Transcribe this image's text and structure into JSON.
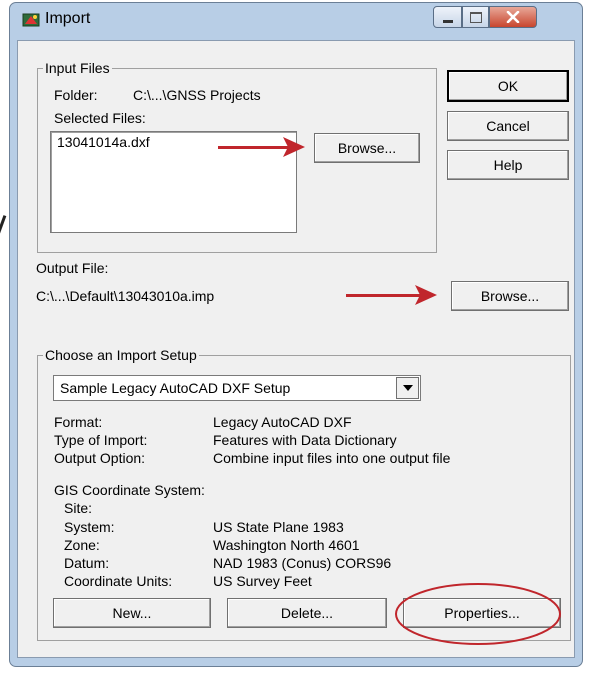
{
  "window": {
    "title": "Import"
  },
  "input_files": {
    "legend": "Input Files",
    "folder_label": "Folder:",
    "folder_value": "C:\\...\\GNSS Projects",
    "selected_label": "Selected Files:",
    "selected_files": [
      "13041014a.dxf"
    ],
    "browse_label": "Browse..."
  },
  "output_file": {
    "label": "Output File:",
    "value": "C:\\...\\Default\\13043010a.imp",
    "browse_label": "Browse..."
  },
  "buttons": {
    "ok": "OK",
    "cancel": "Cancel",
    "help": "Help"
  },
  "setup": {
    "legend": "Choose an Import Setup",
    "selected": "Sample Legacy AutoCAD DXF Setup",
    "details": [
      {
        "label": "Format:",
        "value": "Legacy AutoCAD DXF"
      },
      {
        "label": "Type of Import:",
        "value": "Features with Data Dictionary"
      },
      {
        "label": "Output Option:",
        "value": "Combine input files into one output file"
      }
    ],
    "gis_label": "GIS Coordinate System:",
    "gis": [
      {
        "label": "Site:",
        "value": ""
      },
      {
        "label": "System:",
        "value": "US State Plane 1983"
      },
      {
        "label": "Zone:",
        "value": "Washington North 4601"
      },
      {
        "label": "Datum:",
        "value": "NAD 1983 (Conus) CORS96"
      },
      {
        "label": "Coordinate Units:",
        "value": "US Survey Feet"
      }
    ],
    "new_label": "New...",
    "delete_label": "Delete...",
    "properties_label": "Properties..."
  },
  "colors": {
    "annotation_red": "#c0262c",
    "frame_blue": "#b8cee6",
    "close_red": "#c8462e"
  }
}
